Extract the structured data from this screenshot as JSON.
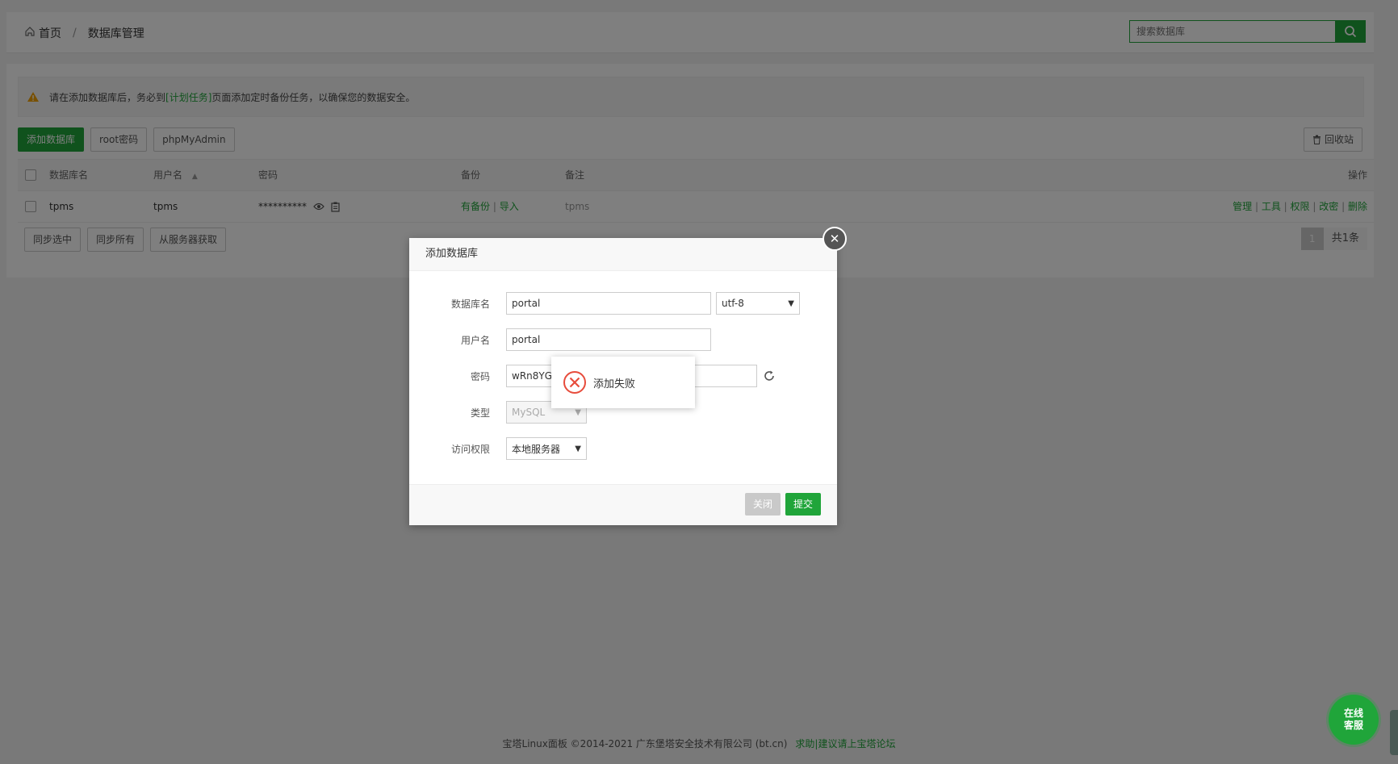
{
  "breadcrumb": {
    "home": "首页",
    "separator": "/",
    "current": "数据库管理"
  },
  "search": {
    "placeholder": "搜索数据库"
  },
  "notice": {
    "before": "请在添加数据库后，务必到",
    "link": "[计划任务]",
    "after": "页面添加定时备份任务，以确保您的数据安全。"
  },
  "toolbar": {
    "add_db": "添加数据库",
    "root_pwd": "root密码",
    "phpmyadmin": "phpMyAdmin",
    "recycle": "回收站"
  },
  "table": {
    "headers": {
      "name": "数据库名",
      "user": "用户名",
      "password": "密码",
      "backup": "备份",
      "remark": "备注",
      "action": "操作"
    },
    "rows": [
      {
        "name": "tpms",
        "user": "tpms",
        "password": "**********",
        "backup_status": "有备份",
        "backup_sep": "|",
        "import": "导入",
        "remark": "tpms",
        "actions": [
          "管理",
          "工具",
          "权限",
          "改密",
          "删除"
        ]
      }
    ]
  },
  "bottom": {
    "sync_selected": "同步选中",
    "sync_all": "同步所有",
    "fetch_server": "从服务器获取"
  },
  "pager": {
    "current": "1",
    "total": "共1条"
  },
  "footer": {
    "copyright": "宝塔Linux面板 ©2014-2021 广东堡塔安全技术有限公司 (bt.cn)",
    "help": "求助|建议请上宝塔论坛"
  },
  "modal": {
    "title": "添加数据库",
    "fields": {
      "db_name_label": "数据库名",
      "db_name_value": "portal",
      "charset": "utf-8",
      "user_label": "用户名",
      "user_value": "portal",
      "pwd_label": "密码",
      "pwd_value": "wRn8YG",
      "type_label": "类型",
      "type_value": "MySQL",
      "access_label": "访问权限",
      "access_value": "本地服务器"
    },
    "close_btn": "关闭",
    "submit_btn": "提交"
  },
  "toast": {
    "message": "添加失败"
  },
  "chat": {
    "line1": "在线",
    "line2": "客服"
  },
  "colors": {
    "brand": "#20a53a",
    "error": "#e74c3c"
  }
}
